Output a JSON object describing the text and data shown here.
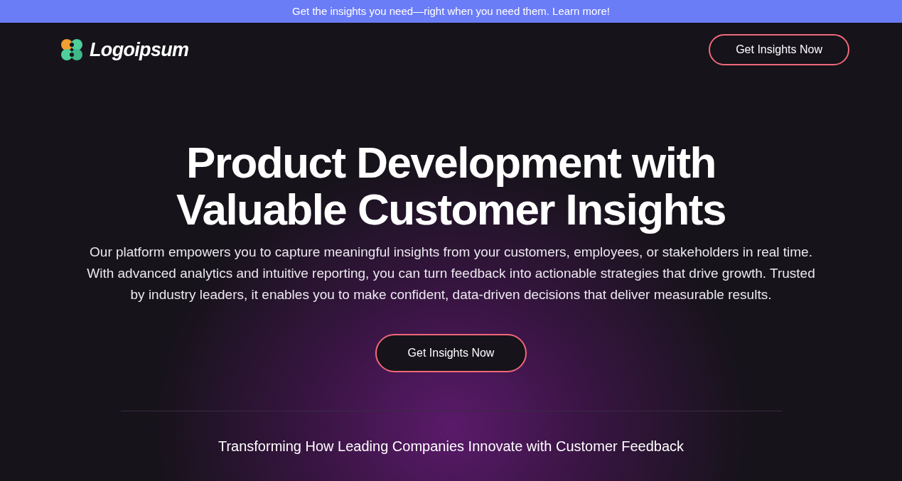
{
  "announcement": "Get the insights you need—right when you need them. Learn more!",
  "header": {
    "logo": "Logoipsum",
    "cta": "Get Insights Now"
  },
  "hero": {
    "title_lines": [
      "Product Development with",
      "Valuable Customer Insights"
    ],
    "description": "Our platform empowers you to capture meaningful insights from your customers, employees, or stakeholders in real time. With advanced analytics and intuitive reporting, you can turn feedback into actionable strategies that drive growth. Trusted by industry leaders, it enables you to make confident, data-driven decisions that deliver measurable results.",
    "cta": "Get Insights Now"
  },
  "logos_section": {
    "heading": "Transforming How Leading Companies Innovate with Customer Feedback"
  }
}
